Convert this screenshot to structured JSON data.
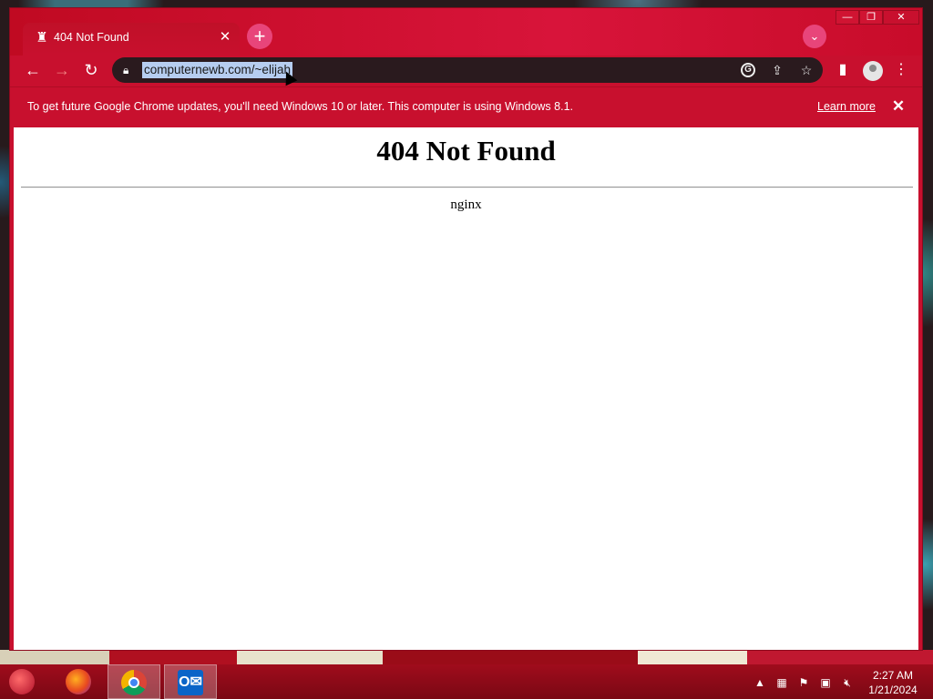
{
  "browser": {
    "tab_title": "404 Not Found",
    "new_tab_symbol": "+",
    "url": "computernewb.com/~elijah",
    "window_controls": {
      "minimize": "—",
      "maximize": "❐",
      "close": "✕"
    }
  },
  "infobar": {
    "message": "To get future Google Chrome updates, you'll need Windows 10 or later. This computer is using Windows 8.1.",
    "link": "Learn more",
    "close_symbol": "✕"
  },
  "page": {
    "heading": "404 Not Found",
    "server": "nginx"
  },
  "taskbar": {
    "apps": [
      "start-orb-icon",
      "firefox-icon",
      "chrome-icon",
      "outlook-icon"
    ],
    "clock_time": "2:27 AM",
    "clock_date": "1/21/2024"
  },
  "colors": {
    "theme_red": "#c8102e",
    "omnibox_bg": "#2a1a1e",
    "selection": "#b6cdf0"
  }
}
